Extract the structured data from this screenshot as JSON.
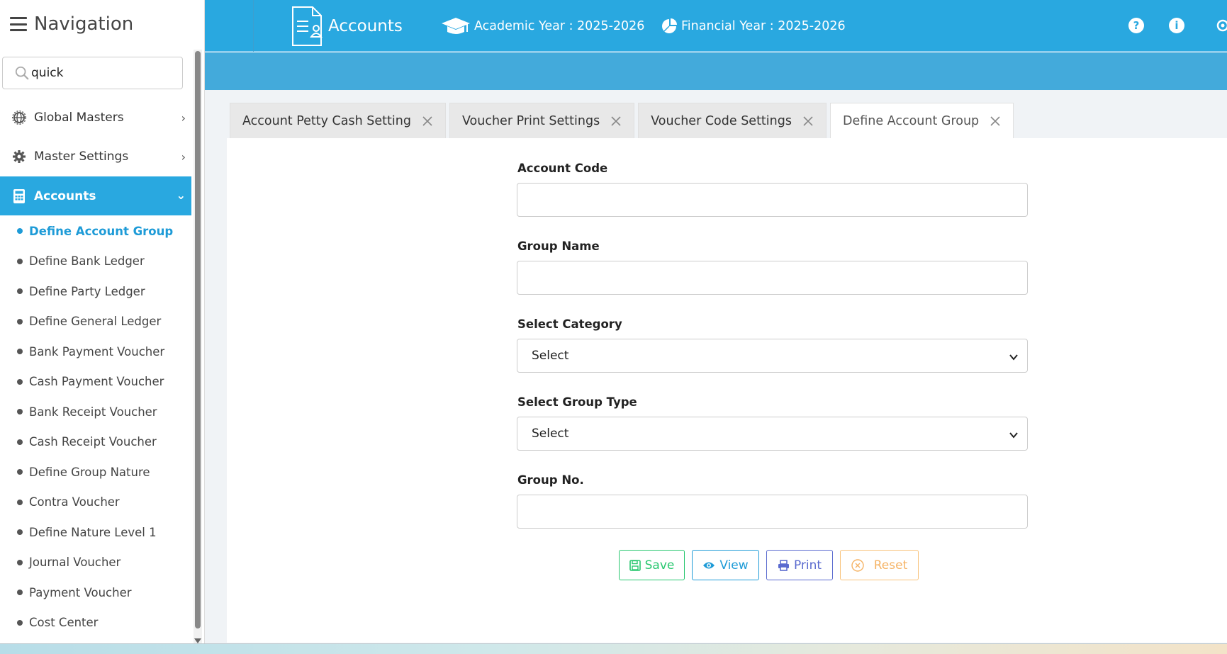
{
  "sidebar": {
    "title": "Navigation",
    "search": {
      "value": "quick",
      "placeholder": ""
    },
    "menu": [
      {
        "label": "Global Masters",
        "icon": "globe-gear-icon"
      },
      {
        "label": "Master Settings",
        "icon": "gear-icon"
      },
      {
        "label": "Accounts",
        "icon": "calculator-icon"
      }
    ],
    "submenu": [
      "Define Account Group",
      "Define Bank Ledger",
      "Define Party Ledger",
      "Define General Ledger",
      "Bank Payment Voucher",
      "Cash Payment Voucher",
      "Bank Receipt Voucher",
      "Cash Receipt Voucher",
      "Define Group Nature",
      "Contra Voucher",
      "Define Nature Level 1",
      "Journal Voucher",
      "Payment Voucher",
      "Cost Center"
    ]
  },
  "header": {
    "module": "Accounts",
    "academic_year": "Academic Year : 2025-2026",
    "financial_year": "Financial Year : 2025-2026",
    "help_icon": "?",
    "info_icon": "i"
  },
  "tabs": [
    "Account Petty Cash Setting",
    "Voucher Print Settings",
    "Voucher Code Settings",
    "Define Account Group"
  ],
  "form": {
    "account_code_label": "Account Code",
    "account_code_value": "",
    "group_name_label": "Group Name",
    "group_name_value": "",
    "category_label": "Select Category",
    "category_value": "Select",
    "group_type_label": "Select Group Type",
    "group_type_value": "Select",
    "group_no_label": "Group No.",
    "group_no_value": ""
  },
  "buttons": {
    "save": "Save",
    "view": "View",
    "print": "Print",
    "reset": "Reset"
  },
  "colors": {
    "primary": "#29a8e0",
    "save": "#28c76f",
    "view": "#1e9bd7",
    "print": "#5a6acf",
    "reset": "#f5b365"
  }
}
